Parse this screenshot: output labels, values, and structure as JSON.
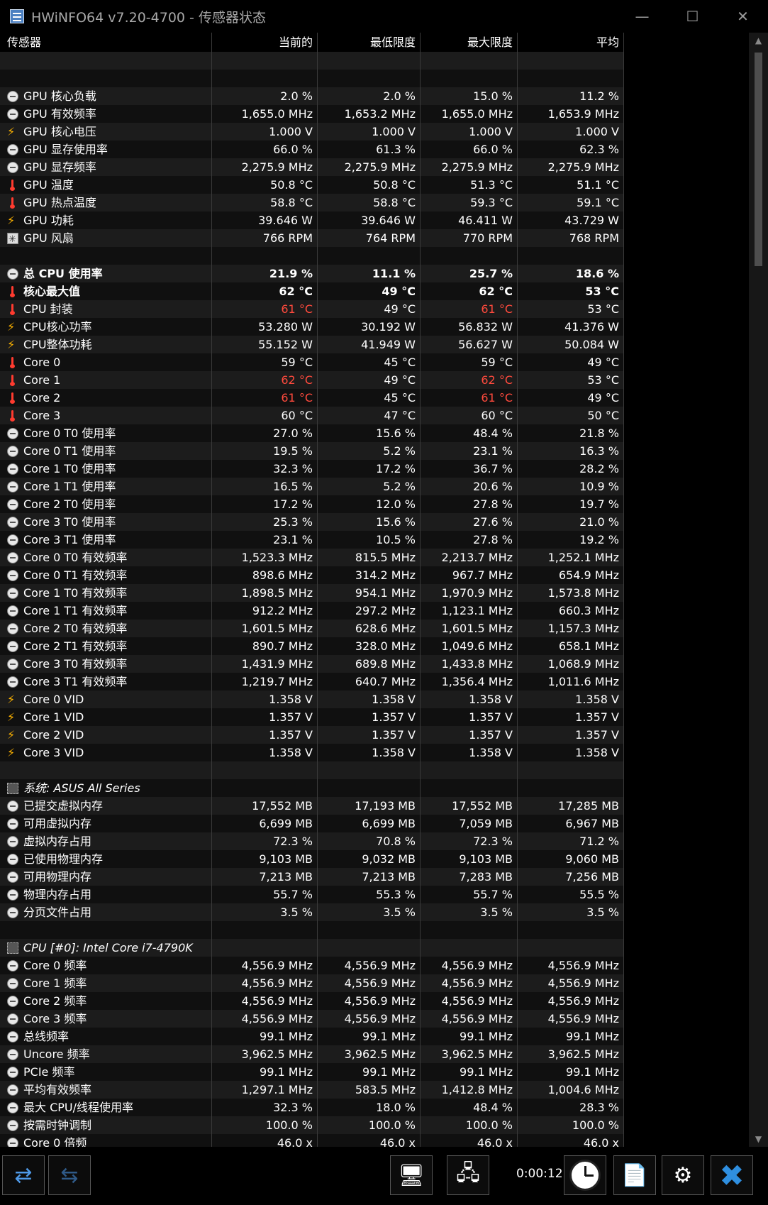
{
  "window": {
    "title": "HWiNFO64 v7.20-4700 - 传感器状态",
    "minimize": "—",
    "maximize": "☐",
    "close": "✕"
  },
  "columns": [
    "传感器",
    "当前的",
    "最低限度",
    "最大限度",
    "平均"
  ],
  "rows": [
    {
      "type": "blank"
    },
    {
      "type": "blank"
    },
    {
      "icon": "clock",
      "name": "GPU 核心负载",
      "cur": "2.0 %",
      "min": "2.0 %",
      "max": "15.0 %",
      "avg": "11.2 %"
    },
    {
      "icon": "clock",
      "name": "GPU 有效频率",
      "cur": "1,655.0 MHz",
      "min": "1,653.2 MHz",
      "max": "1,655.0 MHz",
      "avg": "1,653.9 MHz"
    },
    {
      "icon": "volt",
      "name": "GPU 核心电压",
      "cur": "1.000 V",
      "min": "1.000 V",
      "max": "1.000 V",
      "avg": "1.000 V"
    },
    {
      "icon": "clock",
      "name": "GPU 显存使用率",
      "cur": "66.0 %",
      "min": "61.3 %",
      "max": "66.0 %",
      "avg": "62.3 %"
    },
    {
      "icon": "clock",
      "name": "GPU 显存频率",
      "cur": "2,275.9 MHz",
      "min": "2,275.9 MHz",
      "max": "2,275.9 MHz",
      "avg": "2,275.9 MHz"
    },
    {
      "icon": "temp",
      "name": "GPU 温度",
      "cur": "50.8 °C",
      "min": "50.8 °C",
      "max": "51.3 °C",
      "avg": "51.1 °C"
    },
    {
      "icon": "temp",
      "name": "GPU 热点温度",
      "cur": "58.8 °C",
      "min": "58.8 °C",
      "max": "59.3 °C",
      "avg": "59.1 °C"
    },
    {
      "icon": "volt",
      "name": "GPU 功耗",
      "cur": "39.646 W",
      "min": "39.646 W",
      "max": "46.411 W",
      "avg": "43.729 W"
    },
    {
      "icon": "fan",
      "name": "GPU 风扇",
      "cur": "766 RPM",
      "min": "764 RPM",
      "max": "770 RPM",
      "avg": "768 RPM"
    },
    {
      "type": "blank"
    },
    {
      "icon": "clock",
      "name": "总 CPU 使用率",
      "cur": "21.9 %",
      "min": "11.1 %",
      "max": "25.7 %",
      "avg": "18.6 %",
      "bold": true
    },
    {
      "icon": "temp",
      "name": "核心最大值",
      "cur": "62 °C",
      "min": "49 °C",
      "max": "62 °C",
      "avg": "53 °C",
      "bold": true
    },
    {
      "icon": "temp",
      "name": "CPU 封装",
      "cur": "61 °C",
      "min": "49 °C",
      "max": "61 °C",
      "avg": "53 °C",
      "red": [
        "cur",
        "max"
      ]
    },
    {
      "icon": "volt",
      "name": "CPU核心功率",
      "cur": "53.280 W",
      "min": "30.192 W",
      "max": "56.832 W",
      "avg": "41.376 W"
    },
    {
      "icon": "volt",
      "name": "CPU整体功耗",
      "cur": "55.152 W",
      "min": "41.949 W",
      "max": "56.627 W",
      "avg": "50.084 W"
    },
    {
      "icon": "temp",
      "name": "Core 0",
      "cur": "59 °C",
      "min": "45 °C",
      "max": "59 °C",
      "avg": "49 °C"
    },
    {
      "icon": "temp",
      "name": "Core 1",
      "cur": "62 °C",
      "min": "49 °C",
      "max": "62 °C",
      "avg": "53 °C",
      "red": [
        "cur",
        "max"
      ]
    },
    {
      "icon": "temp",
      "name": "Core 2",
      "cur": "61 °C",
      "min": "45 °C",
      "max": "61 °C",
      "avg": "49 °C",
      "red": [
        "cur",
        "max"
      ]
    },
    {
      "icon": "temp",
      "name": "Core 3",
      "cur": "60 °C",
      "min": "47 °C",
      "max": "60 °C",
      "avg": "50 °C"
    },
    {
      "icon": "clock",
      "name": "Core 0 T0 使用率",
      "cur": "27.0 %",
      "min": "15.6 %",
      "max": "48.4 %",
      "avg": "21.8 %"
    },
    {
      "icon": "clock",
      "name": "Core 0 T1 使用率",
      "cur": "19.5 %",
      "min": "5.2 %",
      "max": "23.1 %",
      "avg": "16.3 %"
    },
    {
      "icon": "clock",
      "name": "Core 1 T0 使用率",
      "cur": "32.3 %",
      "min": "17.2 %",
      "max": "36.7 %",
      "avg": "28.2 %"
    },
    {
      "icon": "clock",
      "name": "Core 1 T1 使用率",
      "cur": "16.5 %",
      "min": "5.2 %",
      "max": "20.6 %",
      "avg": "10.9 %"
    },
    {
      "icon": "clock",
      "name": "Core 2 T0 使用率",
      "cur": "17.2 %",
      "min": "12.0 %",
      "max": "27.8 %",
      "avg": "19.7 %"
    },
    {
      "icon": "clock",
      "name": "Core 3 T0 使用率",
      "cur": "25.3 %",
      "min": "15.6 %",
      "max": "27.6 %",
      "avg": "21.0 %"
    },
    {
      "icon": "clock",
      "name": "Core 3 T1 使用率",
      "cur": "23.1 %",
      "min": "10.5 %",
      "max": "27.8 %",
      "avg": "19.2 %"
    },
    {
      "icon": "clock",
      "name": "Core 0 T0 有效频率",
      "cur": "1,523.3 MHz",
      "min": "815.5 MHz",
      "max": "2,213.7 MHz",
      "avg": "1,252.1 MHz"
    },
    {
      "icon": "clock",
      "name": "Core 0 T1 有效频率",
      "cur": "898.6 MHz",
      "min": "314.2 MHz",
      "max": "967.7 MHz",
      "avg": "654.9 MHz"
    },
    {
      "icon": "clock",
      "name": "Core 1 T0 有效频率",
      "cur": "1,898.5 MHz",
      "min": "954.1 MHz",
      "max": "1,970.9 MHz",
      "avg": "1,573.8 MHz"
    },
    {
      "icon": "clock",
      "name": "Core 1 T1 有效频率",
      "cur": "912.2 MHz",
      "min": "297.2 MHz",
      "max": "1,123.1 MHz",
      "avg": "660.3 MHz"
    },
    {
      "icon": "clock",
      "name": "Core 2 T0 有效频率",
      "cur": "1,601.5 MHz",
      "min": "628.6 MHz",
      "max": "1,601.5 MHz",
      "avg": "1,157.3 MHz"
    },
    {
      "icon": "clock",
      "name": "Core 2 T1 有效频率",
      "cur": "890.7 MHz",
      "min": "328.0 MHz",
      "max": "1,049.6 MHz",
      "avg": "658.1 MHz"
    },
    {
      "icon": "clock",
      "name": "Core 3 T0 有效频率",
      "cur": "1,431.9 MHz",
      "min": "689.8 MHz",
      "max": "1,433.8 MHz",
      "avg": "1,068.9 MHz"
    },
    {
      "icon": "clock",
      "name": "Core 3 T1 有效频率",
      "cur": "1,219.7 MHz",
      "min": "640.7 MHz",
      "max": "1,356.4 MHz",
      "avg": "1,011.6 MHz"
    },
    {
      "icon": "volt",
      "name": "Core 0 VID",
      "cur": "1.358 V",
      "min": "1.358 V",
      "max": "1.358 V",
      "avg": "1.358 V"
    },
    {
      "icon": "volt",
      "name": "Core 1 VID",
      "cur": "1.357 V",
      "min": "1.357 V",
      "max": "1.357 V",
      "avg": "1.357 V"
    },
    {
      "icon": "volt",
      "name": "Core 2 VID",
      "cur": "1.357 V",
      "min": "1.357 V",
      "max": "1.357 V",
      "avg": "1.357 V"
    },
    {
      "icon": "volt",
      "name": "Core 3 VID",
      "cur": "1.358 V",
      "min": "1.358 V",
      "max": "1.358 V",
      "avg": "1.358 V"
    },
    {
      "type": "blank"
    },
    {
      "type": "group",
      "icon": "chip",
      "name": "系统: ASUS All Series"
    },
    {
      "icon": "clock",
      "name": "已提交虚拟内存",
      "cur": "17,552 MB",
      "min": "17,193 MB",
      "max": "17,552 MB",
      "avg": "17,285 MB"
    },
    {
      "icon": "clock",
      "name": "可用虚拟内存",
      "cur": "6,699 MB",
      "min": "6,699 MB",
      "max": "7,059 MB",
      "avg": "6,967 MB"
    },
    {
      "icon": "clock",
      "name": "虚拟内存占用",
      "cur": "72.3 %",
      "min": "70.8 %",
      "max": "72.3 %",
      "avg": "71.2 %"
    },
    {
      "icon": "clock",
      "name": "已使用物理内存",
      "cur": "9,103 MB",
      "min": "9,032 MB",
      "max": "9,103 MB",
      "avg": "9,060 MB"
    },
    {
      "icon": "clock",
      "name": "可用物理内存",
      "cur": "7,213 MB",
      "min": "7,213 MB",
      "max": "7,283 MB",
      "avg": "7,256 MB"
    },
    {
      "icon": "clock",
      "name": "物理内存占用",
      "cur": "55.7 %",
      "min": "55.3 %",
      "max": "55.7 %",
      "avg": "55.5 %"
    },
    {
      "icon": "clock",
      "name": "分页文件占用",
      "cur": "3.5 %",
      "min": "3.5 %",
      "max": "3.5 %",
      "avg": "3.5 %"
    },
    {
      "type": "blank"
    },
    {
      "type": "group",
      "icon": "chip",
      "name": "CPU [#0]: Intel Core i7-4790K"
    },
    {
      "icon": "clock",
      "name": "Core 0 频率",
      "cur": "4,556.9 MHz",
      "min": "4,556.9 MHz",
      "max": "4,556.9 MHz",
      "avg": "4,556.9 MHz"
    },
    {
      "icon": "clock",
      "name": "Core 1 频率",
      "cur": "4,556.9 MHz",
      "min": "4,556.9 MHz",
      "max": "4,556.9 MHz",
      "avg": "4,556.9 MHz"
    },
    {
      "icon": "clock",
      "name": "Core 2 频率",
      "cur": "4,556.9 MHz",
      "min": "4,556.9 MHz",
      "max": "4,556.9 MHz",
      "avg": "4,556.9 MHz"
    },
    {
      "icon": "clock",
      "name": "Core 3 频率",
      "cur": "4,556.9 MHz",
      "min": "4,556.9 MHz",
      "max": "4,556.9 MHz",
      "avg": "4,556.9 MHz"
    },
    {
      "icon": "clock",
      "name": "总线频率",
      "cur": "99.1 MHz",
      "min": "99.1 MHz",
      "max": "99.1 MHz",
      "avg": "99.1 MHz"
    },
    {
      "icon": "clock",
      "name": "Uncore 频率",
      "cur": "3,962.5 MHz",
      "min": "3,962.5 MHz",
      "max": "3,962.5 MHz",
      "avg": "3,962.5 MHz"
    },
    {
      "icon": "clock",
      "name": "PCIe 频率",
      "cur": "99.1 MHz",
      "min": "99.1 MHz",
      "max": "99.1 MHz",
      "avg": "99.1 MHz"
    },
    {
      "icon": "clock",
      "name": "平均有效频率",
      "cur": "1,297.1 MHz",
      "min": "583.5 MHz",
      "max": "1,412.8 MHz",
      "avg": "1,004.6 MHz"
    },
    {
      "icon": "clock",
      "name": "最大 CPU/线程使用率",
      "cur": "32.3 %",
      "min": "18.0 %",
      "max": "48.4 %",
      "avg": "28.3 %"
    },
    {
      "icon": "clock",
      "name": "按需时钟调制",
      "cur": "100.0 %",
      "min": "100.0 %",
      "max": "100.0 %",
      "avg": "100.0 %"
    },
    {
      "icon": "clock",
      "name": "Core 0 倍频",
      "cur": "46.0 x",
      "min": "46.0 x",
      "max": "46.0 x",
      "avg": "46.0 x"
    }
  ],
  "scrollbar": {
    "up": "▲",
    "down": "▼"
  },
  "toolbar": {
    "timer": "0:00:12",
    "nav_left_right": "⇄",
    "nav_collapse": "⇆",
    "network_icon": "🖥",
    "network2_icon": "🖧",
    "report_icon": "📄",
    "settings_icon": "⚙",
    "close_icon": "✖"
  },
  "colors": {
    "background": "#000000",
    "row_odd": "#1c1c1c",
    "row_even": "#101010",
    "alert_red": "#ff4a3d",
    "accent_blue": "#2f8fe0"
  }
}
